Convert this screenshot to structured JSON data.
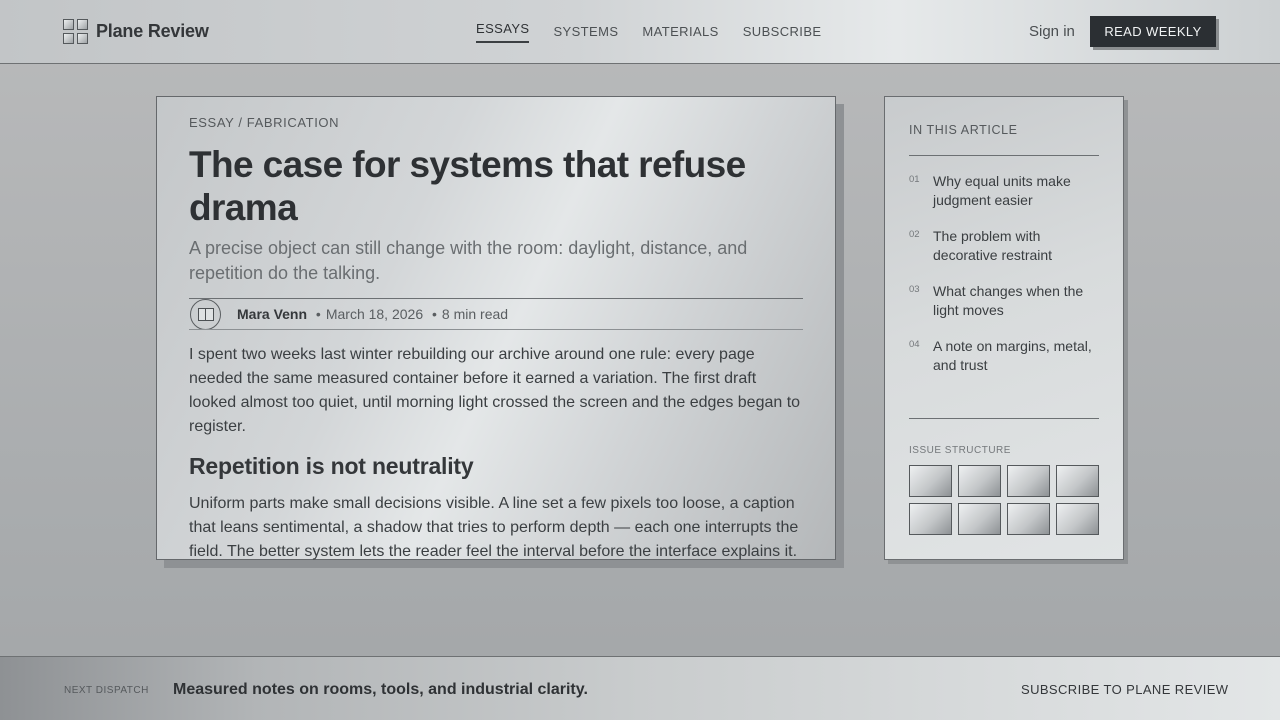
{
  "brand": {
    "name": "Plane Review",
    "logo_icon": "grid-logo-icon"
  },
  "nav": {
    "items": [
      {
        "label": "ESSAYS",
        "active": true
      },
      {
        "label": "SYSTEMS",
        "active": false
      },
      {
        "label": "MATERIALS",
        "active": false
      },
      {
        "label": "SUBSCRIBE",
        "active": false
      }
    ]
  },
  "header": {
    "signin_label": "Sign in",
    "cta_label": "READ WEEKLY"
  },
  "article": {
    "kicker": "ESSAY / FABRICATION",
    "title": "The case for systems that refuse drama",
    "dek": "A precise object can still change with the room: daylight, distance, and repetition do the talking.",
    "author": "Mara Venn",
    "date": "March 18, 2026",
    "read_time": "8 min read",
    "separator": "•",
    "avatar_icon": "open-book-icon",
    "paragraph_1": "I spent two weeks last winter rebuilding our archive around one rule: every page needed the same measured container before it earned a variation. The first draft looked almost too quiet, until morning light crossed the screen and the edges began to register.",
    "subheading": "Repetition is not neutrality",
    "paragraph_2": "Uniform parts make small decisions visible. A line set a few pixels too loose, a caption that leans sentimental, a shadow that tries to perform depth — each one interrupts the field. The better system lets the reader feel the interval before the interface explains it."
  },
  "sidebar": {
    "title": "IN THIS ARTICLE",
    "toc": [
      {
        "num": "01",
        "text": "Why equal units make judgment easier"
      },
      {
        "num": "02",
        "text": "The problem with decorative restraint"
      },
      {
        "num": "03",
        "text": "What changes when the light moves"
      },
      {
        "num": "04",
        "text": "A note on margins, metal, and trust"
      }
    ],
    "structure_label": "ISSUE STRUCTURE",
    "structure_tile_count": 8
  },
  "footer": {
    "label": "NEXT DISPATCH",
    "text": "Measured notes on rooms, tools, and industrial clarity.",
    "link": "SUBSCRIBE TO PLANE REVIEW"
  },
  "colors": {
    "ink": "#2e3134",
    "cta_background": "#2b2f33",
    "cta_text": "#f1f3f4",
    "metal_light": "#e4e7e8",
    "metal_dark": "#8e9194"
  }
}
